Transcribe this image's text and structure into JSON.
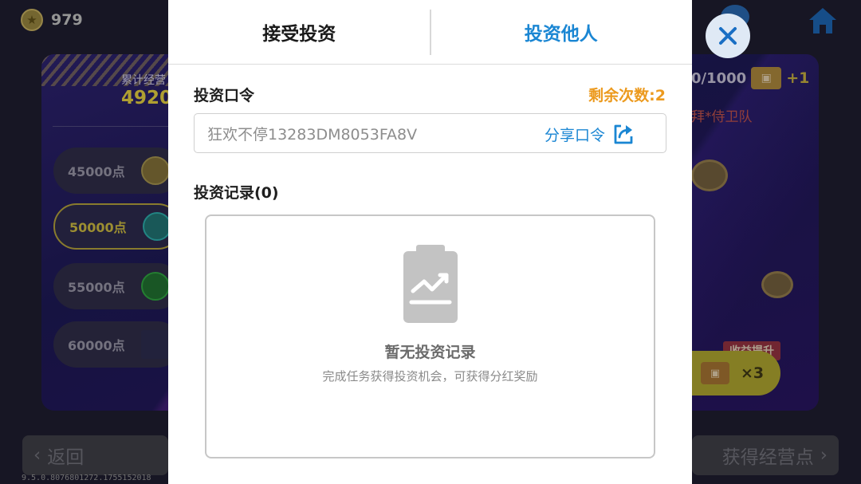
{
  "background": {
    "coin_count": "979",
    "card_label": "累计经营",
    "card_score": "4920",
    "tiers": [
      {
        "label": "45000点",
        "active": false
      },
      {
        "label": "50000点",
        "active": true
      },
      {
        "label": "55000点",
        "active": false
      },
      {
        "label": "60000点",
        "active": false
      }
    ],
    "progress_text": "0/1000",
    "progress_plus": "+1",
    "team_text": "拜*侍卫队",
    "boost_badge": "收益提升",
    "boost_multiplier": "×3",
    "back_label": "返回",
    "get_points_label": "获得经营点",
    "version": "9.5.0.8076801272.1755152018"
  },
  "modal": {
    "tabs": [
      {
        "label": "接受投资",
        "active": false
      },
      {
        "label": "投资他人",
        "active": true
      }
    ],
    "code_section_title": "投资口令",
    "remaining_text": "剩余次数:2",
    "code_value": "狂欢不停13283DM8053FA8V",
    "share_label": "分享口令",
    "records_title": "投资记录(0)",
    "empty_title": "暂无投资记录",
    "empty_subtitle": "完成任务获得投资机会，可获得分红奖励"
  },
  "colors": {
    "accent": "#1a86d3",
    "warning": "#ec9a1e"
  },
  "icons": [
    "home-icon",
    "close-icon",
    "share-icon",
    "clipboard-chart-icon",
    "coin-icon",
    "ticket-icon"
  ]
}
